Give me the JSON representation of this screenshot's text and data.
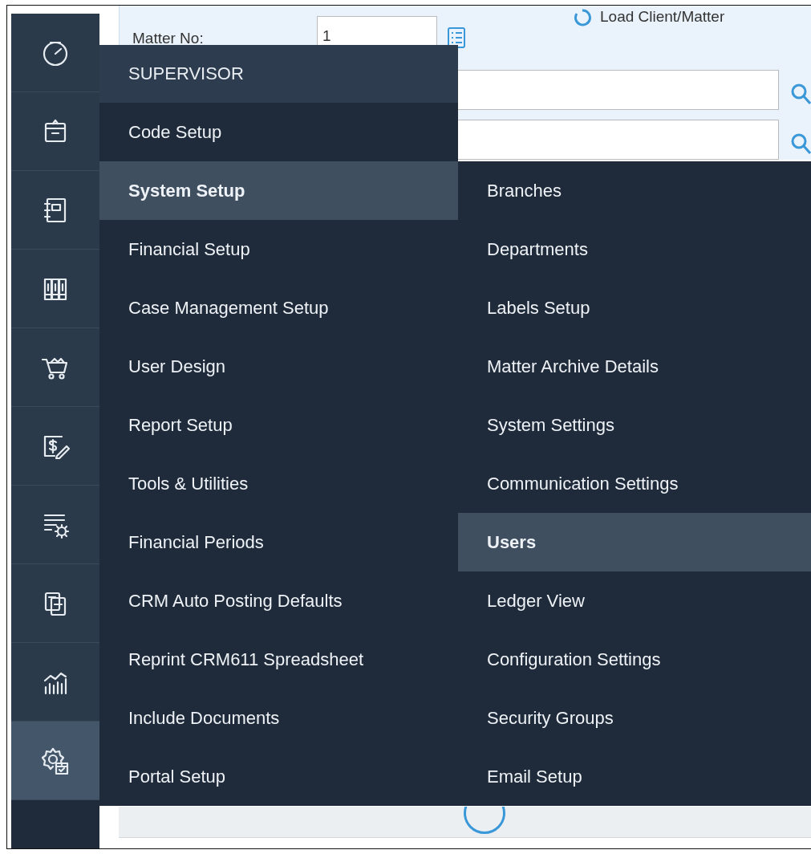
{
  "sidebar": {
    "items": [
      {
        "selected": false
      },
      {
        "selected": false
      },
      {
        "selected": false
      },
      {
        "selected": false
      },
      {
        "selected": false
      },
      {
        "selected": false
      },
      {
        "selected": false
      },
      {
        "selected": false
      },
      {
        "selected": false
      },
      {
        "selected": true
      }
    ]
  },
  "form": {
    "matter_label": "Matter No:",
    "matter_value": "1",
    "load_button": "Load Client/Matter"
  },
  "menu": {
    "header": "SUPERVISOR",
    "items": [
      {
        "label": "Code Setup",
        "selected": false
      },
      {
        "label": "System Setup",
        "selected": true
      },
      {
        "label": "Financial Setup",
        "selected": false
      },
      {
        "label": "Case Management Setup",
        "selected": false
      },
      {
        "label": "User Design",
        "selected": false
      },
      {
        "label": "Report Setup",
        "selected": false
      },
      {
        "label": "Tools & Utilities",
        "selected": false
      },
      {
        "label": "Financial Periods",
        "selected": false
      },
      {
        "label": "CRM Auto Posting Defaults",
        "selected": false
      },
      {
        "label": "Reprint CRM611 Spreadsheet",
        "selected": false
      },
      {
        "label": "Include Documents",
        "selected": false
      },
      {
        "label": "Portal Setup",
        "selected": false
      }
    ],
    "submenu": [
      {
        "label": "Branches",
        "selected": false
      },
      {
        "label": "Departments",
        "selected": false
      },
      {
        "label": "Labels Setup",
        "selected": false
      },
      {
        "label": "Matter Archive Details",
        "selected": false
      },
      {
        "label": "System Settings",
        "selected": false
      },
      {
        "label": "Communication Settings",
        "selected": false
      },
      {
        "label": "Users",
        "selected": true
      },
      {
        "label": "Ledger View",
        "selected": false
      },
      {
        "label": "Configuration Settings",
        "selected": false
      },
      {
        "label": "Security Groups",
        "selected": false
      },
      {
        "label": "Email Setup",
        "selected": false
      }
    ]
  }
}
